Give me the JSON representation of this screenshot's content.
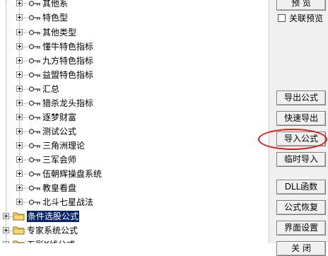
{
  "tree": {
    "child_items": [
      {
        "label": "其他系"
      },
      {
        "label": "特色型"
      },
      {
        "label": "其他类型"
      },
      {
        "label": "懂牛特色指标"
      },
      {
        "label": "九方特色指标"
      },
      {
        "label": "益盟特色指标"
      },
      {
        "label": "汇总"
      },
      {
        "label": "猎杀龙头指标"
      },
      {
        "label": "逐梦财富"
      },
      {
        "label": "测试公式"
      },
      {
        "label": "三角洲理论"
      },
      {
        "label": "三军会师"
      },
      {
        "label": "伍朝辉操盘系统"
      },
      {
        "label": "教皇看盘"
      },
      {
        "label": "北斗七星战法"
      }
    ],
    "root_folders": [
      {
        "label": "条件选股公式",
        "selected": true
      },
      {
        "label": "专家系统公式",
        "selected": false
      },
      {
        "label": "五彩K线公式",
        "selected": false
      }
    ]
  },
  "panel": {
    "preview_button": "预 览",
    "link_preview_checkbox": {
      "label": "关联预览",
      "checked": false
    },
    "buttons": [
      {
        "id": "export-formula",
        "label": "导出公式"
      },
      {
        "id": "quick-export",
        "label": "快速导出"
      },
      {
        "id": "import-formula",
        "label": "导入公式"
      },
      {
        "id": "temp-import",
        "label": "临时导入"
      },
      {
        "id": "dll-function",
        "label": "DLL函数"
      },
      {
        "id": "formula-restore",
        "label": "公式恢复"
      },
      {
        "id": "ui-settings",
        "label": "界面设置"
      },
      {
        "id": "close",
        "label": "关 闭"
      }
    ]
  },
  "colors": {
    "highlight_oval": "#e01818",
    "selected_bg": "#0a246a",
    "folder_fill": "#f5d76e"
  }
}
